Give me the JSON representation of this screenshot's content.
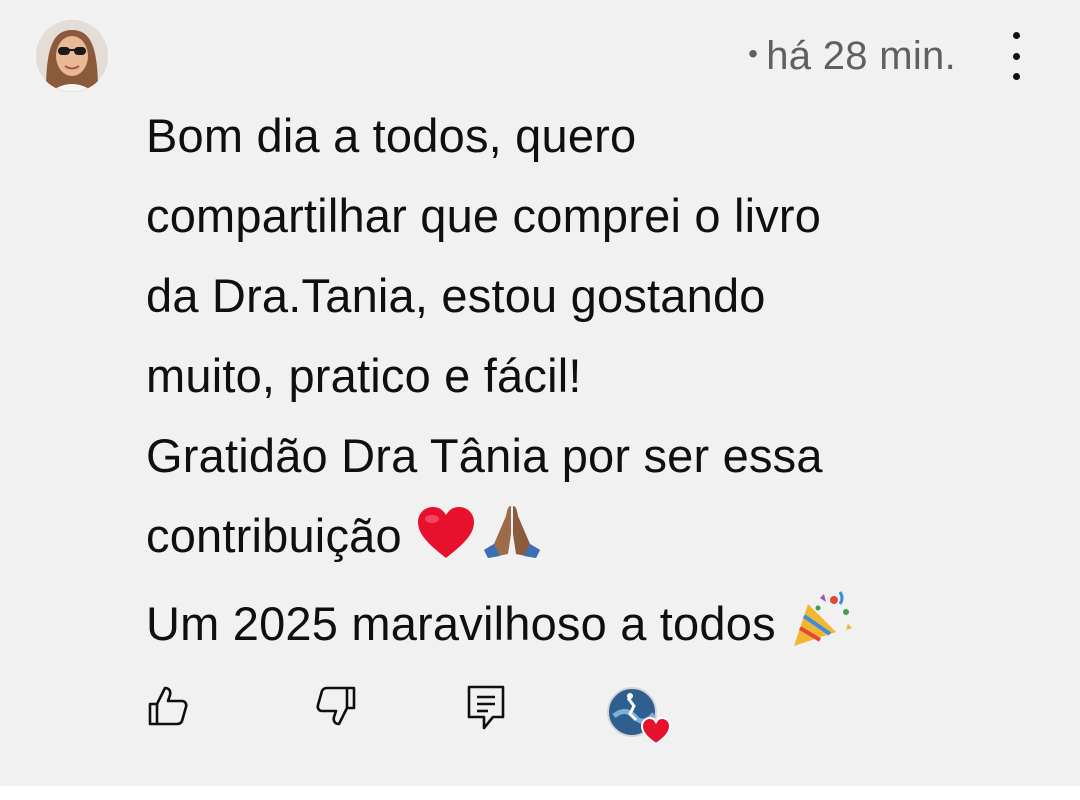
{
  "comment": {
    "timestamp_dot": "•",
    "timestamp": "há 28 min.",
    "text_lines": [
      "Bom dia a todos, quero",
      "compartilhar que comprei o livro",
      "da Dra.Tania, estou gostando",
      "muito, pratico e fácil!",
      "Gratidão Dra Tânia por ser essa",
      "contribuição",
      "Um 2025 maravilhoso a todos"
    ]
  },
  "icons": {
    "avatar": "user-avatar",
    "more": "more-vertical-icon",
    "like": "thumbs-up-icon",
    "dislike": "thumbs-down-icon",
    "reply": "reply-comment-icon",
    "creator_heart": "creator-heart-icon",
    "emoji_heart": "red-heart-emoji",
    "emoji_pray": "praying-hands-emoji",
    "emoji_party": "party-popper-emoji"
  },
  "colors": {
    "background": "#f1f1f1",
    "text": "#0f0f0f",
    "meta": "#606060",
    "heart": "#e8112d"
  }
}
